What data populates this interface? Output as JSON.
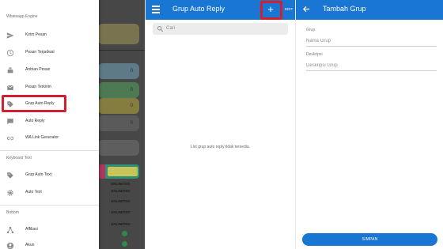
{
  "colors": {
    "primary": "#1976d2",
    "highlight": "#d02030",
    "scrim": "#3c3c3c"
  },
  "drawer": {
    "sections": [
      {
        "title": "Whatsapp Engine"
      },
      {
        "title": "Keyboard Text"
      },
      {
        "title": "Bottom"
      }
    ],
    "items": [
      {
        "label": "Kirim Pesan",
        "icon": "send-icon"
      },
      {
        "label": "Pesan Terjadwal",
        "icon": "clock-icon"
      },
      {
        "label": "Antrian Pesan",
        "icon": "queue-icon"
      },
      {
        "label": "Pesan Terkirim",
        "icon": "mail-icon"
      },
      {
        "label": "Grup Auto Reply",
        "icon": "tag-icon",
        "highlighted": true
      },
      {
        "label": "Auto Reply",
        "icon": "chat-icon"
      },
      {
        "label": "WA Link Generator",
        "icon": "link-icon"
      },
      {
        "label": "Grup Auto Text",
        "icon": "tag-icon"
      },
      {
        "label": "Auto Text",
        "icon": "gear-icon"
      },
      {
        "label": "Affiliasi",
        "icon": "share-icon"
      },
      {
        "label": "Akun",
        "icon": "account-icon"
      }
    ]
  },
  "background_app": {
    "cards": [
      {
        "value": "0"
      },
      {
        "value": "0"
      },
      {
        "value": "0"
      },
      {
        "value": "0"
      }
    ],
    "rows": [
      "UNLIMITED",
      "UNLIMITED",
      "UNLIMITED",
      "UNLIMITED",
      "UNLIMITED"
    ]
  },
  "group_list": {
    "title": "Grup Auto Reply",
    "add_label": "+",
    "edit_label": "EDIT",
    "search_placeholder": "Cari",
    "empty_text": "List grup auto reply tidak tersedia."
  },
  "add_group": {
    "title": "Tambah Grup",
    "name_label": "Grup",
    "name_placeholder": "Nama Grup",
    "desc_label": "Deskripsi",
    "desc_placeholder": "Deskripsi Grup",
    "save_label": "SIMPAN"
  }
}
